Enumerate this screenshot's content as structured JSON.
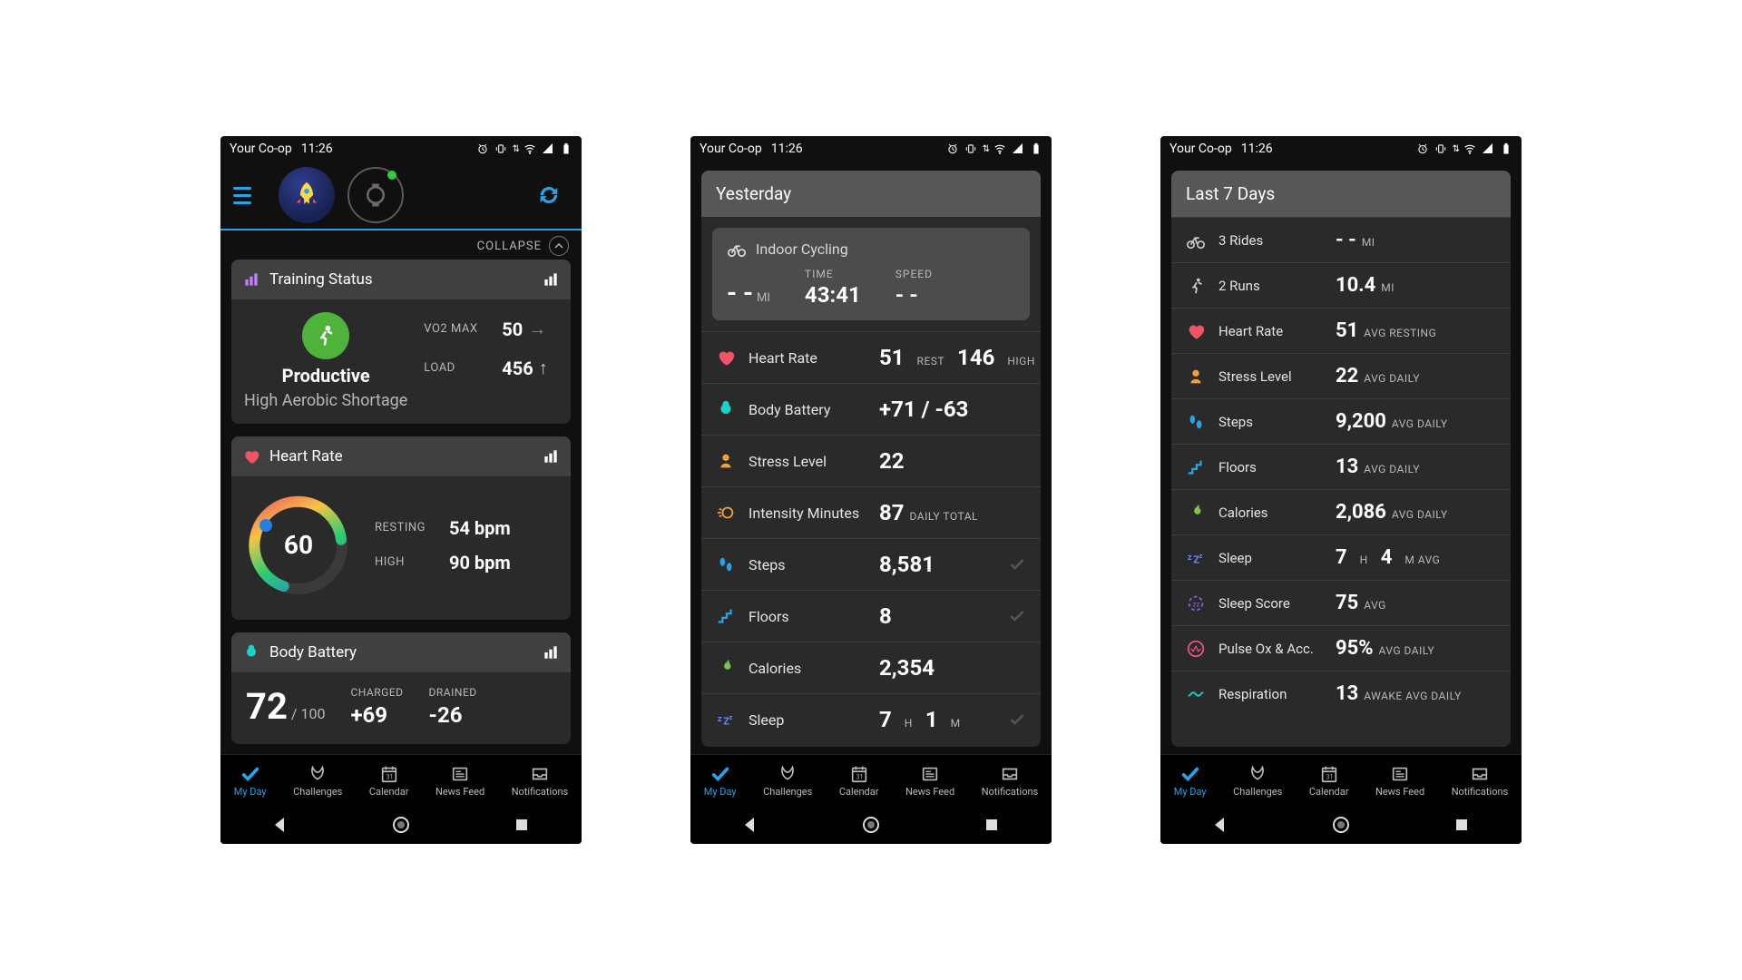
{
  "statusbar": {
    "carrier": "Your Co-op",
    "time": "11:26"
  },
  "collapse": "COLLAPSE",
  "screens": {
    "s1": {
      "training": {
        "header": "Training Status",
        "status": "Productive",
        "sub": "High Aerobic Shortage",
        "vo2lbl": "VO2 MAX",
        "vo2": "50",
        "loadlbl": "LOAD",
        "load": "456"
      },
      "hr": {
        "header": "Heart Rate",
        "value": "60",
        "restlbl": "RESTING",
        "rest": "54 bpm",
        "highlbl": "HIGH",
        "high": "90 bpm"
      },
      "bb": {
        "header": "Body Battery",
        "value": "72",
        "of": "/ 100",
        "chargedlbl": "CHARGED",
        "charged": "+69",
        "drainedlbl": "DRAINED",
        "drained": "-26"
      }
    },
    "s2": {
      "title": "Yesterday",
      "activity": {
        "name": "Indoor Cycling",
        "dist": "- -",
        "distunit": "MI",
        "timelbl": "TIME",
        "time": "43:41",
        "speedlbl": "SPEED",
        "speed": "- -"
      },
      "rows": [
        {
          "icon": "heart",
          "color": "#ef5565",
          "label": "Heart Rate",
          "v1": "51",
          "u1": "REST",
          "v2": "146",
          "u2": "HIGH"
        },
        {
          "icon": "battery",
          "color": "#1fd0c9",
          "label": "Body Battery",
          "v1": "+71 / -63"
        },
        {
          "icon": "stress",
          "color": "#f2a13a",
          "label": "Stress Level",
          "v1": "22"
        },
        {
          "icon": "intensity",
          "color": "#f2a13a",
          "label": "Intensity Minutes",
          "v1": "87",
          "u1": "DAILY TOTAL"
        },
        {
          "icon": "steps",
          "color": "#29a2e6",
          "label": "Steps",
          "v1": "8,581",
          "check": true
        },
        {
          "icon": "floors",
          "color": "#29a2e6",
          "label": "Floors",
          "v1": "8",
          "check": true
        },
        {
          "icon": "calories",
          "color": "#7ec34f",
          "label": "Calories",
          "v1": "2,354"
        },
        {
          "icon": "sleep",
          "color": "#6a8cff",
          "label": "Sleep",
          "v1": "7",
          "u1": "H",
          "v2": "1",
          "u2": "M",
          "check": true
        }
      ]
    },
    "s3": {
      "title": "Last 7 Days",
      "rows": [
        {
          "icon": "bike",
          "color": "#cccccc",
          "label": "3 Rides",
          "v1": "- -",
          "u1": "MI"
        },
        {
          "icon": "run",
          "color": "#cccccc",
          "label": "2 Runs",
          "v1": "10.4",
          "u1": "MI"
        },
        {
          "icon": "heart",
          "color": "#ef5565",
          "label": "Heart Rate",
          "v1": "51",
          "u1": "AVG RESTING"
        },
        {
          "icon": "stress",
          "color": "#f2a13a",
          "label": "Stress Level",
          "v1": "22",
          "u1": "AVG DAILY"
        },
        {
          "icon": "steps",
          "color": "#29a2e6",
          "label": "Steps",
          "v1": "9,200",
          "u1": "AVG DAILY"
        },
        {
          "icon": "floors",
          "color": "#29a2e6",
          "label": "Floors",
          "v1": "13",
          "u1": "AVG DAILY"
        },
        {
          "icon": "calories",
          "color": "#7ec34f",
          "label": "Calories",
          "v1": "2,086",
          "u1": "AVG DAILY"
        },
        {
          "icon": "sleep",
          "color": "#6a8cff",
          "label": "Sleep",
          "v1": "7",
          "u1": "H",
          "v2": "4",
          "u2": "M AVG"
        },
        {
          "icon": "sleepscore",
          "color": "#8a60d6",
          "label": "Sleep Score",
          "v1": "75",
          "u1": "AVG"
        },
        {
          "icon": "pulseox",
          "color": "#e65383",
          "label": "Pulse Ox & Acc.",
          "v1": "95%",
          "u1": "AVG DAILY"
        },
        {
          "icon": "resp",
          "color": "#1fd0c9",
          "label": "Respiration",
          "v1": "13",
          "u1": "AWAKE AVG DAILY"
        }
      ]
    }
  },
  "nav": {
    "myday": "My Day",
    "challenges": "Challenges",
    "calendar": "Calendar",
    "newsfeed": "News Feed",
    "notifications": "Notifications"
  }
}
